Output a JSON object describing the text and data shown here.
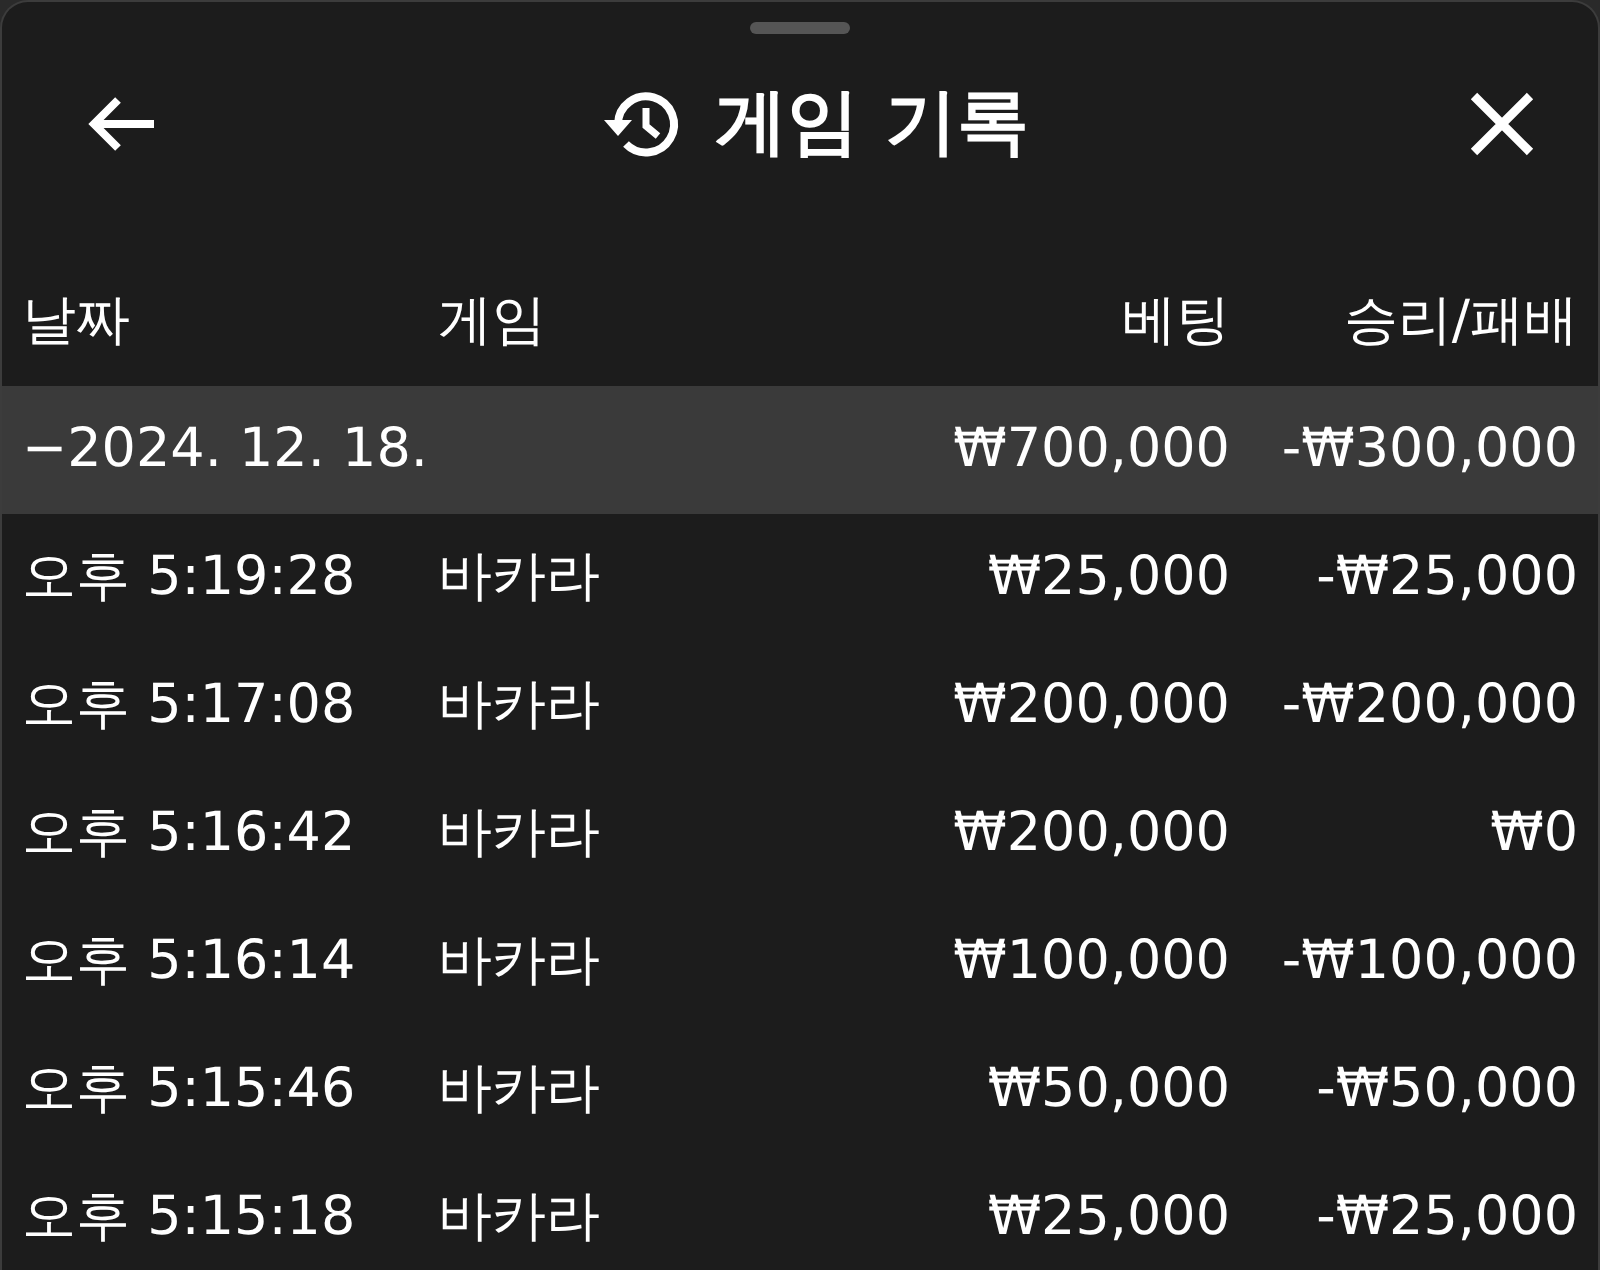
{
  "header": {
    "title": "게임 기록"
  },
  "table": {
    "columns": [
      "날짜",
      "게임",
      "베팅",
      "승리/패배"
    ],
    "group": {
      "date": "−2024. 12. 18.",
      "bet": "₩700,000",
      "result": "-₩300,000"
    },
    "rows": [
      {
        "time": "오후 5:19:28",
        "game": "바카라",
        "bet": "₩25,000",
        "result": "-₩25,000"
      },
      {
        "time": "오후 5:17:08",
        "game": "바카라",
        "bet": "₩200,000",
        "result": "-₩200,000"
      },
      {
        "time": "오후 5:16:42",
        "game": "바카라",
        "bet": "₩200,000",
        "result": "₩0"
      },
      {
        "time": "오후 5:16:14",
        "game": "바카라",
        "bet": "₩100,000",
        "result": "-₩100,000"
      },
      {
        "time": "오후 5:15:46",
        "game": "바카라",
        "bet": "₩50,000",
        "result": "-₩50,000"
      },
      {
        "time": "오후 5:15:18",
        "game": "바카라",
        "bet": "₩25,000",
        "result": "-₩25,000"
      }
    ]
  }
}
